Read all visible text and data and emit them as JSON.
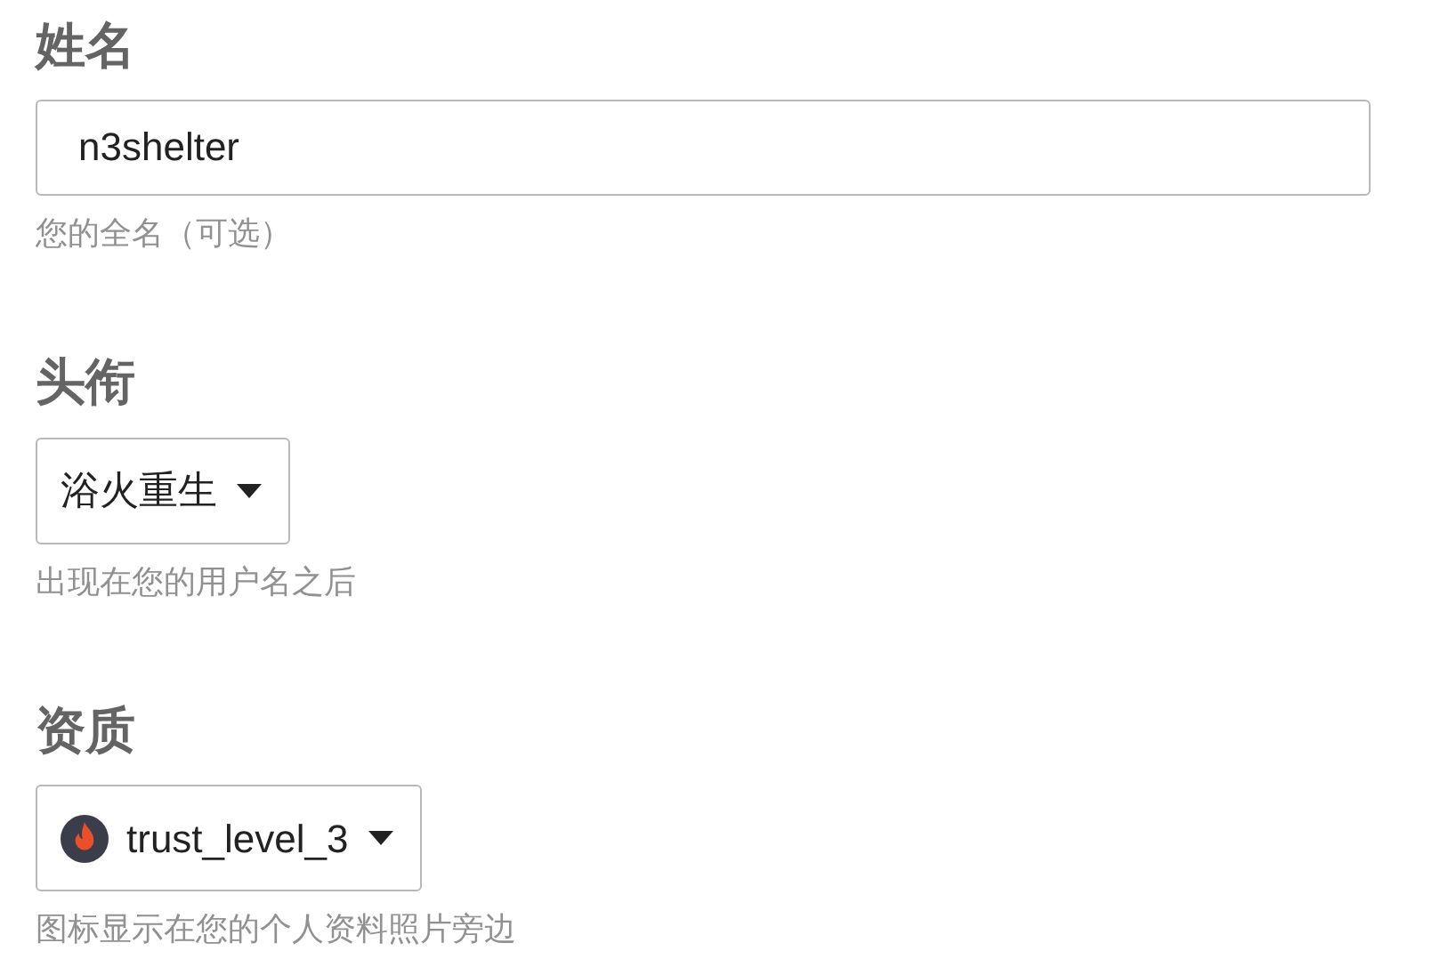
{
  "fields": [
    {
      "kind": "text",
      "label": "姓名",
      "value": "n3shelter",
      "hint": "您的全名（可选）"
    },
    {
      "kind": "dropdown",
      "label": "头衔",
      "value": "浴火重生",
      "hint": "出现在您的用户名之后"
    },
    {
      "kind": "badge-dropdown",
      "label": "资质",
      "value": "trust_level_3",
      "hint": "图标显示在您的个人资料照片旁边"
    }
  ]
}
